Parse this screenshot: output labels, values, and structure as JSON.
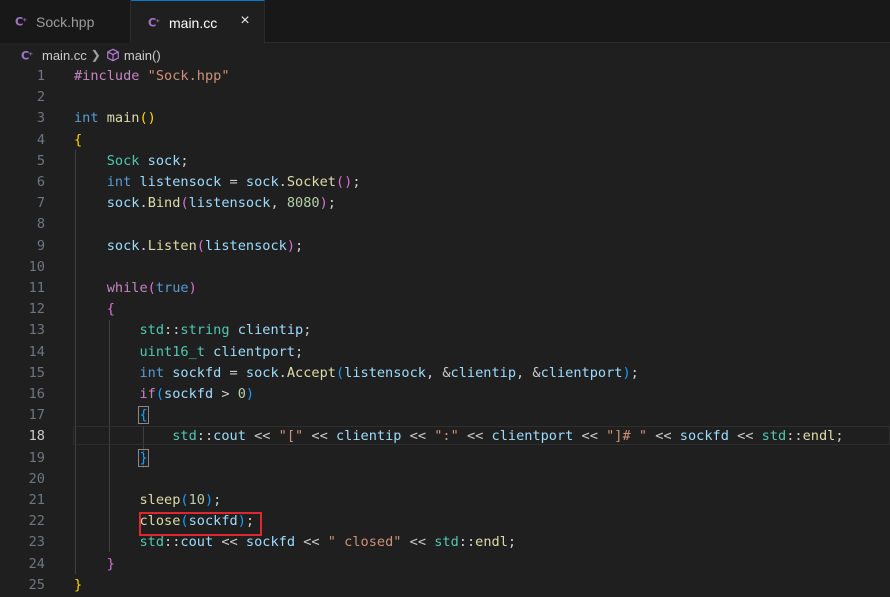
{
  "tabs": [
    {
      "label": "Sock.hpp",
      "active": false
    },
    {
      "label": "main.cc",
      "active": true,
      "close": "×"
    }
  ],
  "breadcrumb": {
    "file": "main.cc",
    "symbol": "main()"
  },
  "colors": {
    "accent": "#0078d4",
    "cpp_icon": "#a074c4",
    "highlight_box": "#e0262f"
  },
  "icons": {
    "cpp": "cpp-file-icon",
    "function": "cube-icon"
  },
  "active_line": 18,
  "lines": [
    {
      "n": "1"
    },
    {
      "n": "2"
    },
    {
      "n": "3"
    },
    {
      "n": "4"
    },
    {
      "n": "5"
    },
    {
      "n": "6"
    },
    {
      "n": "7"
    },
    {
      "n": "8"
    },
    {
      "n": "9"
    },
    {
      "n": "10"
    },
    {
      "n": "11"
    },
    {
      "n": "12"
    },
    {
      "n": "13"
    },
    {
      "n": "14"
    },
    {
      "n": "15"
    },
    {
      "n": "16"
    },
    {
      "n": "17"
    },
    {
      "n": "18"
    },
    {
      "n": "19"
    },
    {
      "n": "20"
    },
    {
      "n": "21"
    },
    {
      "n": "22"
    },
    {
      "n": "23"
    },
    {
      "n": "24"
    },
    {
      "n": "25"
    }
  ],
  "code": [
    [
      [
        "pre",
        "#include "
      ],
      [
        "str",
        "\"Sock.hpp\""
      ]
    ],
    [],
    [
      [
        "kw",
        "int "
      ],
      [
        "fn",
        "main"
      ],
      [
        "b1",
        "()"
      ]
    ],
    [
      [
        "b1",
        "{"
      ]
    ],
    [
      [
        "",
        "    "
      ],
      [
        "ty",
        "Sock"
      ],
      [
        "var",
        " sock"
      ],
      [
        "",
        ";"
      ]
    ],
    [
      [
        "",
        "    "
      ],
      [
        "kw",
        "int "
      ],
      [
        "var",
        "listensock"
      ],
      [
        "",
        " = "
      ],
      [
        "var",
        "sock"
      ],
      [
        "",
        "."
      ],
      [
        "fn",
        "Socket"
      ],
      [
        "b2",
        "()"
      ],
      [
        "",
        ";"
      ]
    ],
    [
      [
        "",
        "    "
      ],
      [
        "var",
        "sock"
      ],
      [
        "",
        "."
      ],
      [
        "fn",
        "Bind"
      ],
      [
        "b2",
        "("
      ],
      [
        "var",
        "listensock"
      ],
      [
        "",
        ", "
      ],
      [
        "num",
        "8080"
      ],
      [
        "b2",
        ")"
      ],
      [
        "",
        ";"
      ]
    ],
    [],
    [
      [
        "",
        "    "
      ],
      [
        "var",
        "sock"
      ],
      [
        "",
        "."
      ],
      [
        "fn",
        "Listen"
      ],
      [
        "b2",
        "("
      ],
      [
        "var",
        "listensock"
      ],
      [
        "b2",
        ")"
      ],
      [
        "",
        ";"
      ]
    ],
    [],
    [
      [
        "",
        "    "
      ],
      [
        "ctl",
        "while"
      ],
      [
        "b2",
        "("
      ],
      [
        "kw",
        "true"
      ],
      [
        "b2",
        ")"
      ]
    ],
    [
      [
        "",
        "    "
      ],
      [
        "b2",
        "{"
      ]
    ],
    [
      [
        "",
        "        "
      ],
      [
        "ns",
        "std"
      ],
      [
        "",
        "::"
      ],
      [
        "ty",
        "string"
      ],
      [
        "var",
        " clientip"
      ],
      [
        "",
        ";"
      ]
    ],
    [
      [
        "",
        "        "
      ],
      [
        "ty",
        "uint16_t"
      ],
      [
        "var",
        " clientport"
      ],
      [
        "",
        ";"
      ]
    ],
    [
      [
        "",
        "        "
      ],
      [
        "kw",
        "int "
      ],
      [
        "var",
        "sockfd"
      ],
      [
        "",
        " = "
      ],
      [
        "var",
        "sock"
      ],
      [
        "",
        "."
      ],
      [
        "fn",
        "Accept"
      ],
      [
        "b3",
        "("
      ],
      [
        "var",
        "listensock"
      ],
      [
        "",
        ", &"
      ],
      [
        "var",
        "clientip"
      ],
      [
        "",
        ", &"
      ],
      [
        "var",
        "clientport"
      ],
      [
        "b3",
        ")"
      ],
      [
        "",
        ";"
      ]
    ],
    [
      [
        "",
        "        "
      ],
      [
        "ctl",
        "if"
      ],
      [
        "b3",
        "("
      ],
      [
        "var",
        "sockfd"
      ],
      [
        "",
        " > "
      ],
      [
        "num",
        "0"
      ],
      [
        "b3",
        ")"
      ]
    ],
    [
      [
        "",
        "        "
      ],
      [
        "b3 hl-brace",
        "{"
      ]
    ],
    [
      [
        "",
        "            "
      ],
      [
        "ns",
        "std"
      ],
      [
        "",
        "::"
      ],
      [
        "var",
        "cout"
      ],
      [
        "",
        " << "
      ],
      [
        "str",
        "\"[\""
      ],
      [
        "",
        " << "
      ],
      [
        "var",
        "clientip"
      ],
      [
        "",
        " << "
      ],
      [
        "str",
        "\":\""
      ],
      [
        "",
        " << "
      ],
      [
        "var",
        "clientport"
      ],
      [
        "",
        " << "
      ],
      [
        "str",
        "\"]# \""
      ],
      [
        "",
        " << "
      ],
      [
        "var",
        "sockfd"
      ],
      [
        "",
        " << "
      ],
      [
        "ns",
        "std"
      ],
      [
        "",
        "::"
      ],
      [
        "fn",
        "endl"
      ],
      [
        "",
        ";"
      ]
    ],
    [
      [
        "",
        "        "
      ],
      [
        "b3 hl-brace",
        "}"
      ]
    ],
    [],
    [
      [
        "",
        "        "
      ],
      [
        "fn",
        "sleep"
      ],
      [
        "b3",
        "("
      ],
      [
        "num",
        "10"
      ],
      [
        "b3",
        ")"
      ],
      [
        "",
        ";"
      ]
    ],
    [
      [
        "",
        "        "
      ],
      [
        "fn",
        "close"
      ],
      [
        "b3",
        "("
      ],
      [
        "var",
        "sockfd"
      ],
      [
        "b3",
        ")"
      ],
      [
        "",
        ";"
      ]
    ],
    [
      [
        "",
        "        "
      ],
      [
        "ns",
        "std"
      ],
      [
        "",
        "::"
      ],
      [
        "var",
        "cout"
      ],
      [
        "",
        " << "
      ],
      [
        "var",
        "sockfd"
      ],
      [
        "",
        " << "
      ],
      [
        "str",
        "\" closed\""
      ],
      [
        "",
        " << "
      ],
      [
        "ns",
        "std"
      ],
      [
        "",
        "::"
      ],
      [
        "fn",
        "endl"
      ],
      [
        "",
        ";"
      ]
    ],
    [
      [
        "",
        "    "
      ],
      [
        "b2",
        "}"
      ]
    ],
    [
      [
        "b1",
        "}"
      ]
    ]
  ]
}
